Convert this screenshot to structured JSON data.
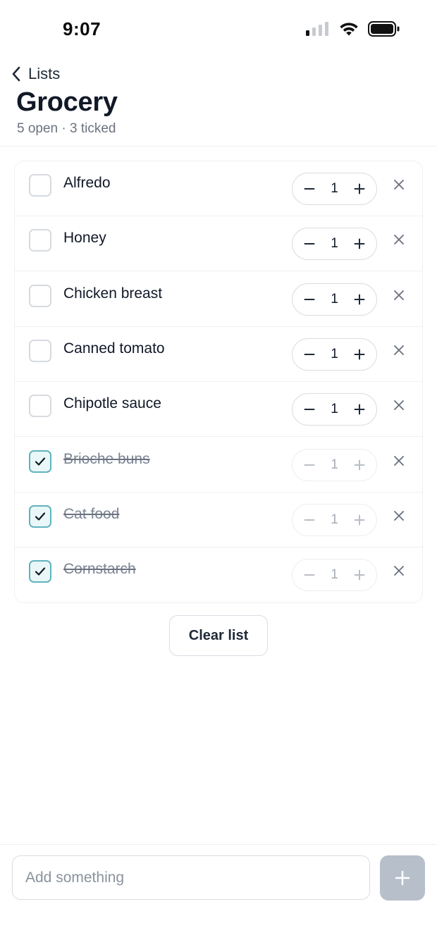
{
  "status_bar": {
    "time": "9:07"
  },
  "header": {
    "back_label": "Lists",
    "title": "Grocery",
    "subtitle": "5 open · 3 ticked"
  },
  "items": [
    {
      "name": "Alfredo",
      "qty": "1",
      "checked": false
    },
    {
      "name": "Honey",
      "qty": "1",
      "checked": false
    },
    {
      "name": "Chicken breast",
      "qty": "1",
      "checked": false
    },
    {
      "name": "Canned tomato",
      "qty": "1",
      "checked": false
    },
    {
      "name": "Chipotle sauce",
      "qty": "1",
      "checked": false
    },
    {
      "name": "Brioche buns",
      "qty": "1",
      "checked": true
    },
    {
      "name": "Cat food",
      "qty": "1",
      "checked": true
    },
    {
      "name": "Cornstarch",
      "qty": "1",
      "checked": true
    }
  ],
  "actions": {
    "clear_label": "Clear list"
  },
  "composer": {
    "placeholder": "Add something"
  },
  "colors": {
    "accent": "#5fb3bd",
    "add_button": "#b6bfca",
    "muted_text": "#6b7280"
  }
}
